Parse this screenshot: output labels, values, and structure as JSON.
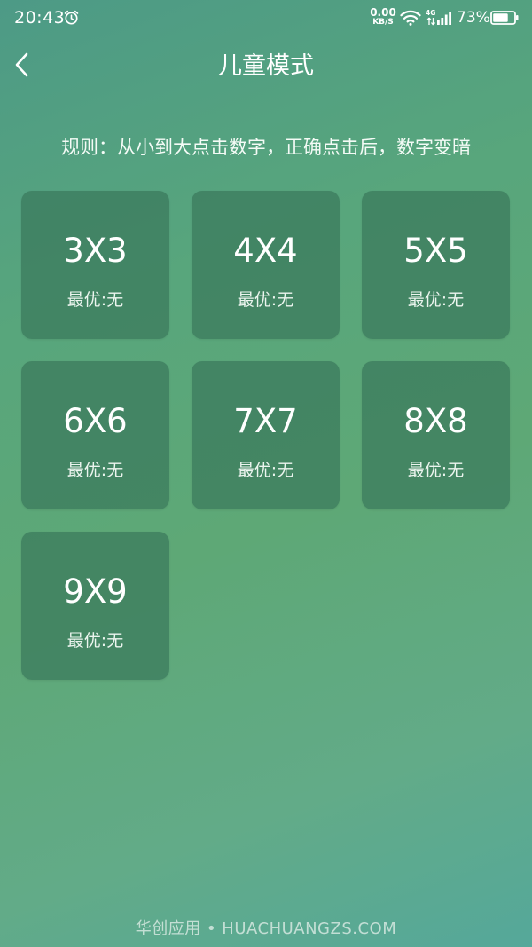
{
  "status_bar": {
    "time": "20:43",
    "net_speed_value": "0.00",
    "net_speed_unit": "KB/S",
    "network_type": "4G",
    "battery_percent": "73%",
    "battery_level": 0.73,
    "icons": [
      "alarm-icon",
      "wifi-icon",
      "signal-icon",
      "battery-icon"
    ]
  },
  "header": {
    "back_icon": "chevron-left-icon",
    "title": "儿童模式"
  },
  "rules": "规则：从小到大点击数字，正确点击后，数字变暗",
  "levels": [
    {
      "size": "3X3",
      "best": "最优:无"
    },
    {
      "size": "4X4",
      "best": "最优:无"
    },
    {
      "size": "5X5",
      "best": "最优:无"
    },
    {
      "size": "6X6",
      "best": "最优:无"
    },
    {
      "size": "7X7",
      "best": "最优:无"
    },
    {
      "size": "8X8",
      "best": "最优:无"
    },
    {
      "size": "9X9",
      "best": "最优:无"
    }
  ],
  "watermark": "华创应用 • HUACHUANGZS.COM"
}
